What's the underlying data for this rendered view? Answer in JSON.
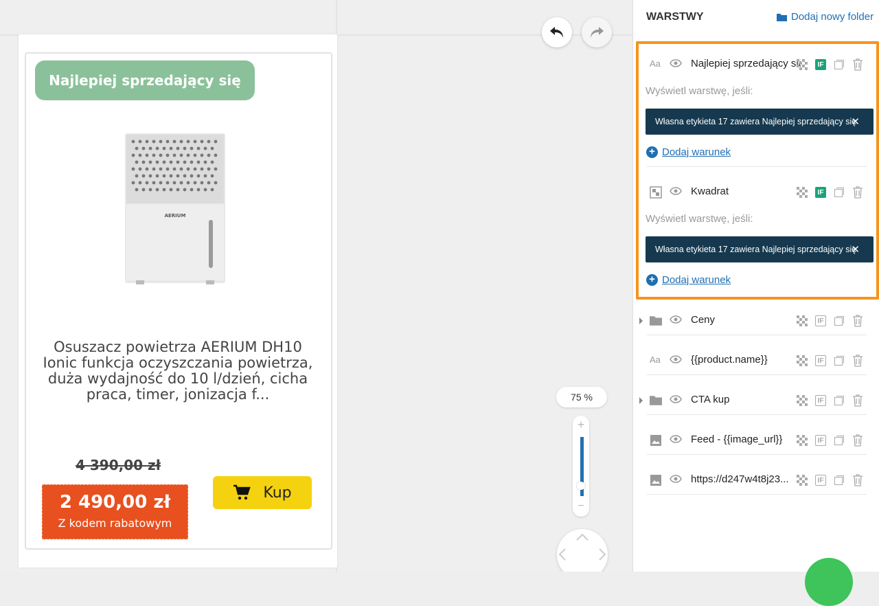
{
  "preview": {
    "badge": "Najlepiej sprzedający się",
    "brand_on_device": "AERIUM",
    "product_name_lines": [
      "Osuszacz powietrza AERIUM DH10",
      "Ionic funkcja oczyszczania powietrza,",
      "duża wydajność do 10 l/dzień, cicha",
      "praca, timer, jonizacja f..."
    ],
    "old_price": "4 390,00 zł",
    "price": "2 490,00 zł",
    "price_note": "Z kodem rabatowym",
    "buy_label": "Kup"
  },
  "zoom": {
    "label": "75 %",
    "level_fraction": 0.75
  },
  "panel": {
    "title": "WARSTWY",
    "add_folder": "Dodaj nowy folder",
    "condition_label": "Wyświetl warstwę, jeśli:",
    "condition_chip": "Własna etykieta 17 zawiera Najlepiej sprzedający się",
    "add_condition": "Dodaj warunek",
    "type_text_glyph": "Aa",
    "layers": [
      {
        "name": "Najlepiej sprzedający się",
        "type": "text",
        "if_active": true
      },
      {
        "name": "Kwadrat",
        "type": "shape",
        "if_active": true
      },
      {
        "name": "Ceny",
        "type": "folder",
        "if_active": false
      },
      {
        "name": "{{product.name}}",
        "type": "text",
        "if_active": false
      },
      {
        "name": "CTA kup",
        "type": "folder",
        "if_active": false
      },
      {
        "name": "Feed - {{image_url}}",
        "type": "image",
        "if_active": false
      },
      {
        "name": "https://d247w4t8j23...",
        "type": "image",
        "if_active": false
      }
    ],
    "if_label": "IF"
  },
  "colors": {
    "accent": "#1f6fb3",
    "highlight": "#f7941d",
    "badge": "#8bc19a",
    "price_bg": "#e8501f",
    "buy_btn": "#f5d20f",
    "if_active": "#1aa37a",
    "chip_bg": "#16394f"
  }
}
